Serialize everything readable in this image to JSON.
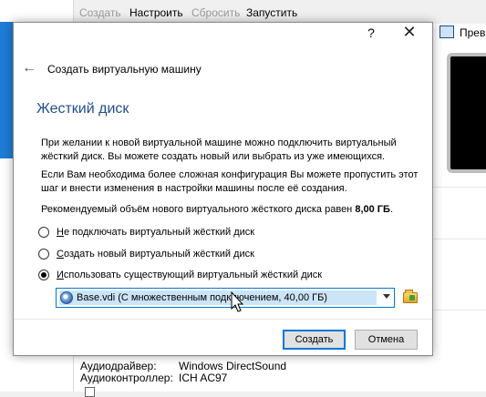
{
  "toolbar": {
    "create_label": "Создать",
    "settings_label": "Настроить",
    "reset_label": "Сбросить",
    "start_label": "Запустить"
  },
  "preview": {
    "label": "Прев"
  },
  "details": {
    "audio_driver_label": "Аудиодрайвер:",
    "audio_driver_value": "Windows DirectSound",
    "audio_controller_label": "Аудиоконтроллер:",
    "audio_controller_value": "ICH AC97"
  },
  "dialog": {
    "help_label": "?",
    "close_label": "✕",
    "back_label": "←",
    "wizard_title": "Создать виртуальную машину",
    "section_title": "Жесткий диск",
    "para1_line1": "При желании к новой виртуальной машине можно подключить виртуальный",
    "para1_line2": "жёсткий диск. Вы можете создать новый или выбрать из уже имеющихся.",
    "para2_line1": "Если Вам необходима более сложная конфигурация Вы можете пропустить этот",
    "para2_line2": "шаг и внести изменения в настройки машины после её создания.",
    "para3_text": "Рекомендуемый объём нового виртуального жёсткого диска равен ",
    "para3_value": "8,00 ГБ",
    "para3_end": ".",
    "options": [
      {
        "mnemonic": "Н",
        "rest": "е подключать виртуальный жёсткий диск",
        "checked": false
      },
      {
        "mnemonic": "С",
        "rest": "оздать новый виртуальный жёсткий диск",
        "checked": false
      },
      {
        "mnemonic": "И",
        "rest": "спользовать существующий виртуальный жёсткий диск",
        "checked": true
      }
    ],
    "disk_selected": "Base.vdi (С множественным подключением, 40,00 ГБ)",
    "create_button": "Создать",
    "cancel_button": "Отмена"
  },
  "colors": {
    "accent": "#0078d7",
    "title_blue": "#1f4e8c",
    "selection": "#cce4f7"
  },
  "icons": [
    "disk-icon",
    "folder-icon",
    "help-icon",
    "close-icon",
    "back-arrow-icon",
    "preview-icon",
    "mouse-cursor-icon"
  ]
}
